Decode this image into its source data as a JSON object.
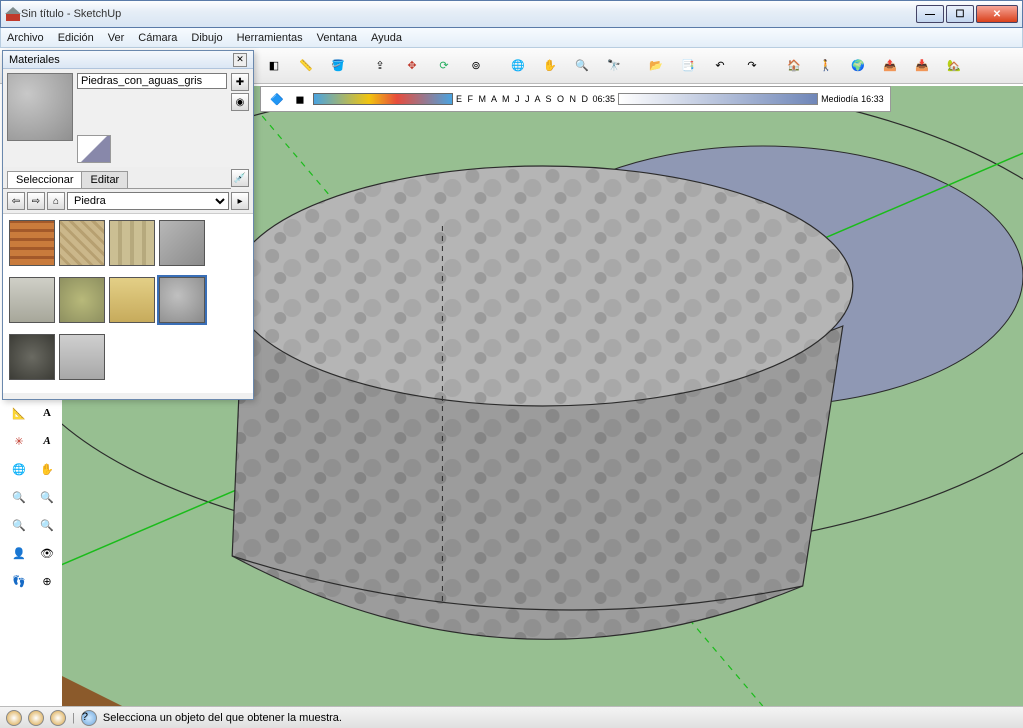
{
  "window": {
    "title": "Sin título - SketchUp"
  },
  "menu": {
    "items": [
      "Archivo",
      "Edición",
      "Ver",
      "Cámara",
      "Dibujo",
      "Herramientas",
      "Ventana",
      "Ayuda"
    ]
  },
  "shadow": {
    "months": "E F M A M J J A S O N D",
    "time_start": "06:35",
    "noon": "Mediodía",
    "time_end": "16:33"
  },
  "materials": {
    "panel_title": "Materiales",
    "current_name": "Piedras_con_aguas_gris",
    "tab_select": "Seleccionar",
    "tab_edit": "Editar",
    "library": "Piedra",
    "swatches": [
      {
        "name": "sandstone-brick",
        "css": "repeating-linear-gradient(0deg,#c97b3c 0 6px,#a3592a 6px 9px)"
      },
      {
        "name": "ashlar-tan",
        "css": "repeating-linear-gradient(45deg,#cbb78a 0 5px,#b7a071 5px 8px)"
      },
      {
        "name": "limestone-block",
        "css": "repeating-linear-gradient(90deg,#cbbf93 0 8px,#b6a97d 8px 12px)"
      },
      {
        "name": "flagstone-gray",
        "css": "linear-gradient(135deg,#b7b7b7,#8b8b8b)"
      },
      {
        "name": "travertine",
        "css": "linear-gradient(#cfcfc7,#a7a79a)"
      },
      {
        "name": "marble-green",
        "css": "radial-gradient(circle,#b8b97a,#8e9060)"
      },
      {
        "name": "sandstone-yellow",
        "css": "linear-gradient(#e3cf86,#c7ab5c)"
      },
      {
        "name": "granite-gray",
        "css": "radial-gradient(circle at 40% 40%,#c0c0c0,#8a8a8a)",
        "selected": true
      },
      {
        "name": "granite-dark",
        "css": "radial-gradient(circle,#6a6a62,#3c3c36)"
      },
      {
        "name": "concrete-light",
        "css": "linear-gradient(#cfcfcf,#a8a8a8)"
      }
    ]
  },
  "status": {
    "hint": "Selecciona un objeto del que obtener la muestra."
  },
  "icons": {
    "select": "↖",
    "line": "／",
    "rect": "▭",
    "circle": "◯",
    "arc": "⌒",
    "make": "⬚",
    "eraser": "◧",
    "tape": "📏",
    "paint": "🪣",
    "push": "⇪",
    "move": "✥",
    "rotate": "⟳",
    "offset": "⊚",
    "orbit": "🌐",
    "pan": "✋",
    "zoom": "🔍",
    "zext": "🔭",
    "prev": "📂",
    "layers": "📑",
    "undo": "↶",
    "redo": "↷",
    "house": "🏠",
    "person": "🚶",
    "globe": "🌍",
    "export": "📤",
    "import": "📥",
    "newhouse": "🏡"
  }
}
